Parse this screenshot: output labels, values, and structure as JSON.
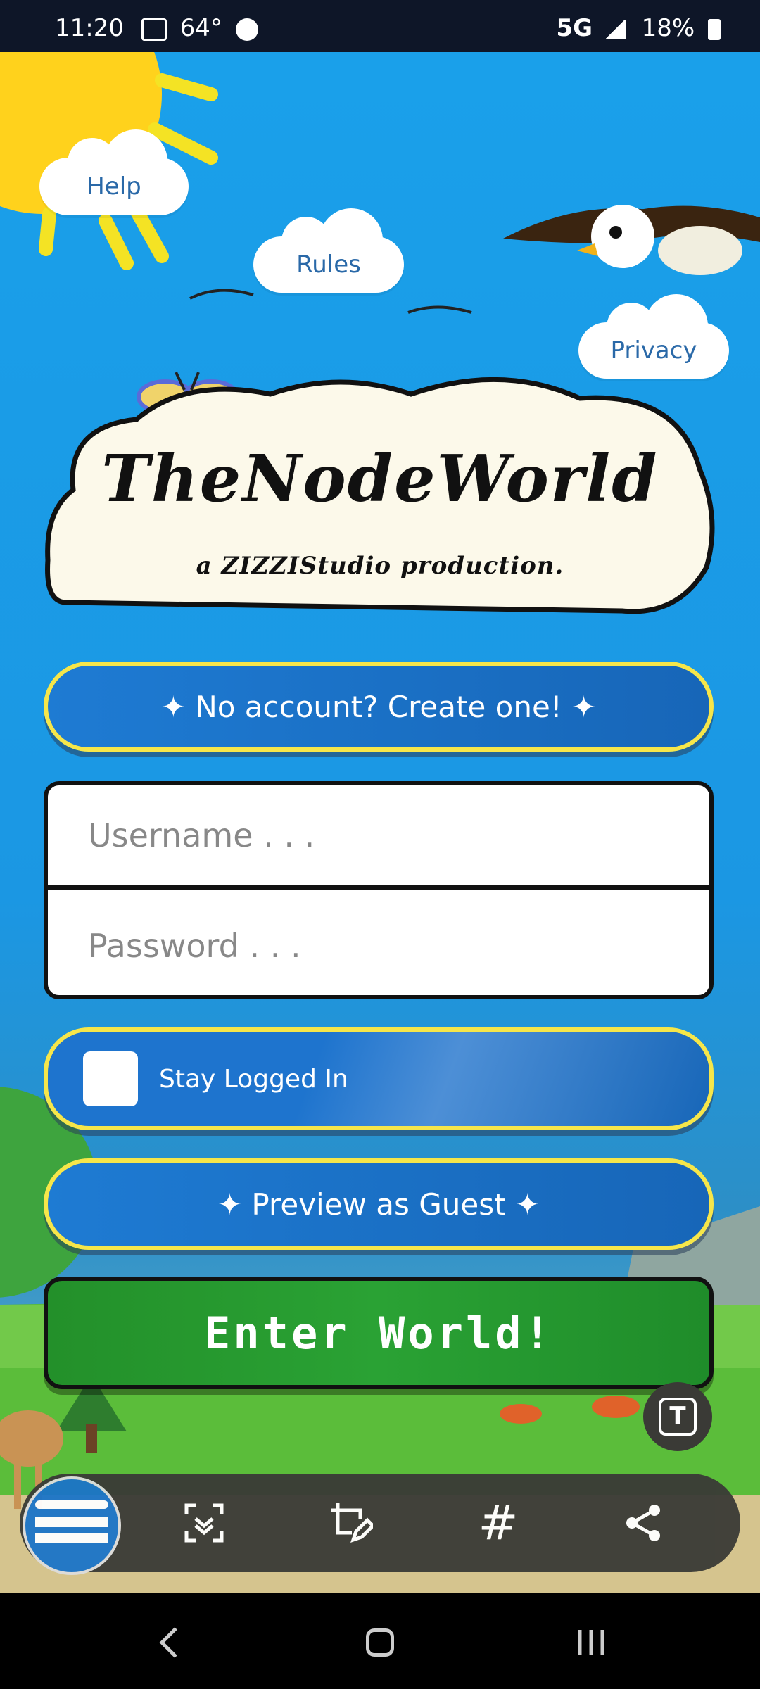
{
  "status_bar": {
    "time": "11:20",
    "temp": "64°",
    "network": "5G",
    "battery": "18%"
  },
  "nav_clouds": {
    "help": "Help",
    "rules": "Rules",
    "privacy": "Privacy"
  },
  "banner": {
    "title": "TheNodeWorld",
    "subtitle": "a ZIZZIStudio production."
  },
  "buttons": {
    "create_account": "✦ No account? Create one! ✦",
    "stay_logged_in": "Stay Logged In",
    "preview_guest": "✦ Preview as Guest ✦",
    "enter_world": "Enter World!"
  },
  "form": {
    "username_placeholder": "Username . . .",
    "password_placeholder": "Password . . ."
  },
  "toolbar": {
    "icons": [
      "screenshot-thumbnail",
      "scan-icon",
      "crop-edit-icon",
      "hashtag-icon",
      "share-icon"
    ]
  },
  "colors": {
    "sky": "#1aa0ea",
    "button_blue": "#1e7bd3",
    "button_border": "#f6e64a",
    "enter_green": "#2aa234"
  }
}
